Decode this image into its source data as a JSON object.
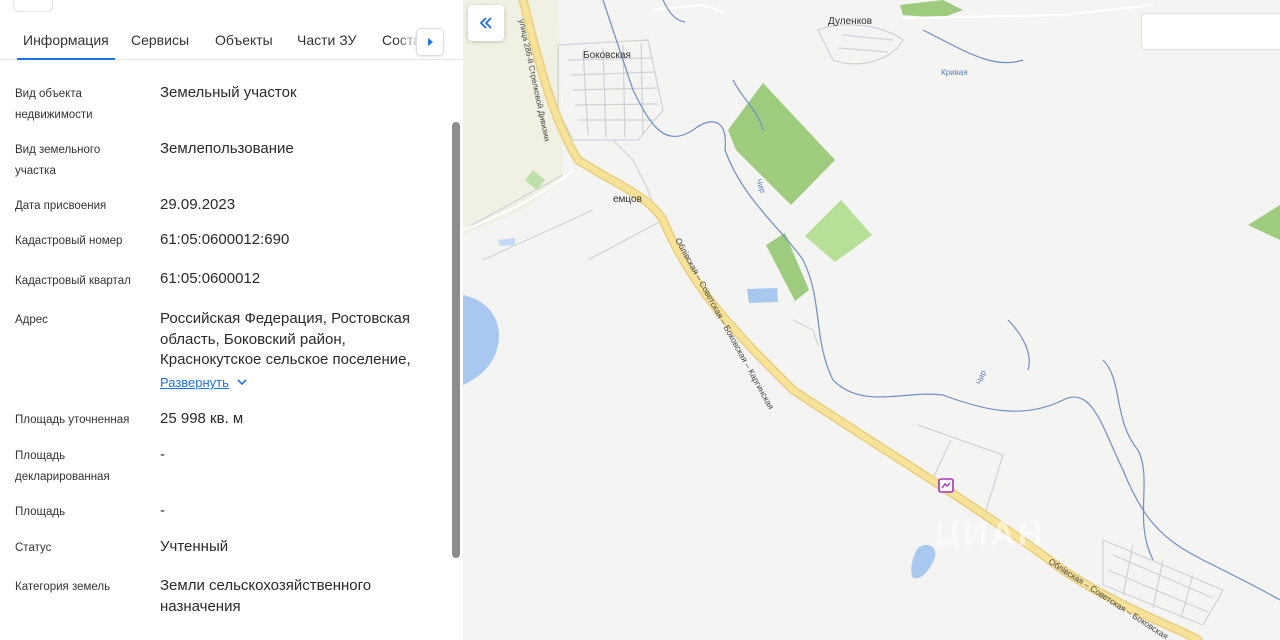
{
  "tabs": [
    {
      "label": "Информация"
    },
    {
      "label": "Сервисы"
    },
    {
      "label": "Объекты"
    },
    {
      "label": "Части ЗУ"
    },
    {
      "label": "Соста"
    }
  ],
  "properties": [
    {
      "label": "Вид объекта недвижимости",
      "value": "Земельный участок"
    },
    {
      "label": "Вид земельного участка",
      "value": "Землепользование"
    },
    {
      "label": "Дата присвоения",
      "value": "29.09.2023"
    },
    {
      "label": "Кадастровый номер",
      "value": "61:05:0600012:690"
    },
    {
      "label": "Кадастровый квартал",
      "value": "61:05:0600012"
    },
    {
      "label": "Адрес",
      "value": "Российская Федерация, Ростовская область, Боковский район, Краснокутское сельское поселение,"
    },
    {
      "label": "Площадь уточненная",
      "value": "25 998 кв. м"
    },
    {
      "label": "Площадь декларированная",
      "value": "-"
    },
    {
      "label": "Площадь",
      "value": "-"
    },
    {
      "label": "Статус",
      "value": "Учтенный"
    },
    {
      "label": "Категория земель",
      "value": "Земли сельскохозяйственного назначения"
    }
  ],
  "address_expand_label": "Развернуть",
  "map": {
    "labels": {
      "village1": "Боковская",
      "village2": "Дуленков",
      "village3": "емцов",
      "river1": "Кривая",
      "river2": "Чир",
      "river3": "Чир",
      "street1": "улица 286-й Стрелковой Дивизии",
      "road": "Облівская – Советская – Боковская – Каргинская",
      "road2": "Облівская – Советская – Боковская"
    },
    "watermark": "ЦИАН",
    "colors": {
      "road": "#f7e29a",
      "river": "#6e8fc4",
      "forest": "#9fcb7e",
      "water": "#a9c8f0",
      "accent": "#1a73e8",
      "poi": "#a235b8"
    }
  }
}
